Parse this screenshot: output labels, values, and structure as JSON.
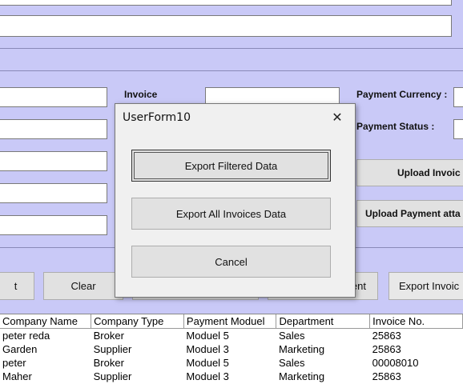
{
  "form": {
    "labels": {
      "invoice": "Invoice",
      "payment_currency": "Payment Currency :",
      "payment_status": "Payment Status :"
    },
    "buttons": {
      "upload_invoice": "Upload Invoic",
      "upload_payment": "Upload Payment atta",
      "left_partial": "t",
      "clear": "Clear",
      "ent_partial": "ent",
      "export_invoice": "Export Invoic"
    }
  },
  "grid": {
    "headers": [
      "Company Name",
      "Company Type",
      "Payment Moduel",
      "Department",
      "Invoice No."
    ],
    "rows": [
      [
        "peter reda",
        "Broker",
        "Moduel 5",
        "Sales",
        "25863"
      ],
      [
        "Garden",
        "Supplier",
        "Moduel 3",
        "Marketing",
        "25863"
      ],
      [
        "peter",
        "Broker",
        "Moduel 5",
        "Sales",
        "00008010"
      ],
      [
        "Maher",
        "Supplier",
        "Moduel 3",
        "Marketing",
        "25863"
      ]
    ]
  },
  "dialog": {
    "title": "UserForm10",
    "close_glyph": "✕",
    "export_filtered": "Export Filtered Data",
    "export_all": "Export All Invoices Data",
    "cancel": "Cancel"
  }
}
